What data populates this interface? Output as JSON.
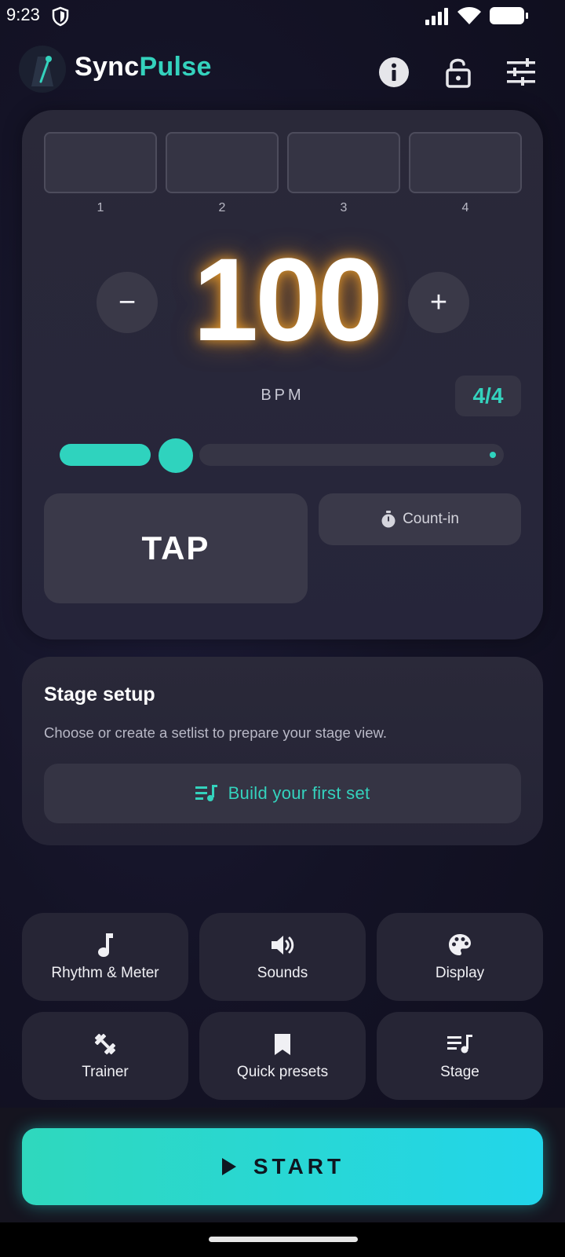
{
  "status_bar": {
    "time": "9:23"
  },
  "header": {
    "brand_part1": "Sync",
    "brand_part2": "Pulse"
  },
  "metronome": {
    "beats": [
      "1",
      "2",
      "3",
      "4"
    ],
    "bpm": "100",
    "bpm_label": "BPM",
    "decrement_label": "−",
    "increment_label": "+",
    "time_signature": "4/4",
    "tempo_slider_fraction": 0.27,
    "tap_label": "TAP",
    "count_in_label": "Count-in"
  },
  "stage_setup": {
    "title": "Stage setup",
    "description": "Choose or create a setlist to prepare your stage view.",
    "button_label": "Build your first set"
  },
  "tiles": [
    {
      "label": "Rhythm & Meter",
      "icon": "music-note-icon"
    },
    {
      "label": "Sounds",
      "icon": "speaker-icon"
    },
    {
      "label": "Display",
      "icon": "palette-icon"
    },
    {
      "label": "Trainer",
      "icon": "dumbbell-icon"
    },
    {
      "label": "Quick presets",
      "icon": "bookmark-icon"
    },
    {
      "label": "Stage",
      "icon": "playlist-icon"
    }
  ],
  "start_label": "START",
  "colors": {
    "accent": "#34d2bd",
    "start_gradient_end": "#22d6ea",
    "bpm_glow": "#ffaa28"
  }
}
